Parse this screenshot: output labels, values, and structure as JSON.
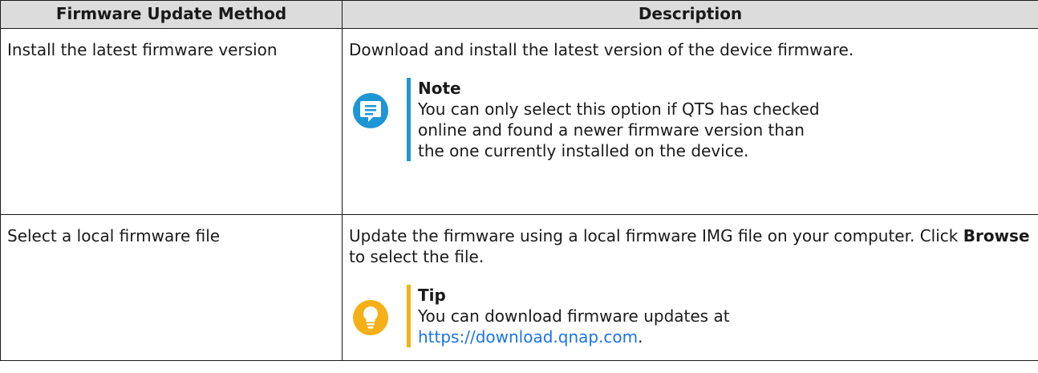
{
  "table": {
    "headers": [
      "Firmware Update Method",
      "Description"
    ],
    "rows": [
      {
        "method": "Install the latest firmware version",
        "description": "Download and install the latest version of the device firmware.",
        "callout": {
          "type": "note",
          "icon": "note-icon",
          "color": "#1e96d6",
          "title": "Note",
          "body": "You can only select this option if QTS has checked online and found a newer firmware version than the one currently installed on the device."
        }
      },
      {
        "method": "Select a local firmware file",
        "description_before": "Update the firmware using a local firmware IMG file on your computer. Click ",
        "description_bold": "Browse",
        "description_after": " to select the file.",
        "callout": {
          "type": "tip",
          "icon": "lightbulb-icon",
          "color": "#f5b019",
          "title": "Tip",
          "body_before": "You can download firmware updates at ",
          "link_text": "https://download.qnap.com",
          "body_after": "."
        }
      }
    ]
  },
  "colors": {
    "header_bg": "#dcdcdc",
    "border": "#1a1a1a",
    "link": "#1a73e8",
    "note_accent": "#1e96d6",
    "tip_accent": "#f5b019"
  }
}
